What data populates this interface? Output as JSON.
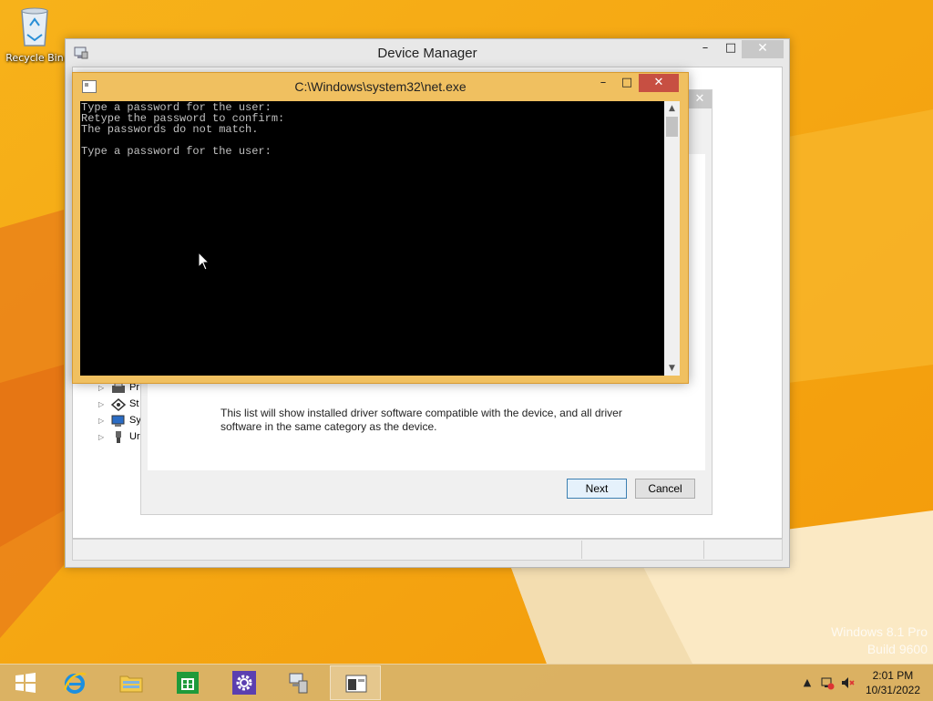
{
  "desktop": {
    "recycle_bin_label": "Recycle Bin",
    "watermark_line1": "Windows 8.1 Pro",
    "watermark_line2": "Build 9600"
  },
  "device_manager": {
    "title": "Device Manager",
    "minimize": "–",
    "maximize": "□",
    "close": "✕",
    "tree_items": [
      {
        "label": "Pr",
        "icon": "printer-icon"
      },
      {
        "label": "St",
        "icon": "storage-icon"
      },
      {
        "label": "Sy",
        "icon": "system-icon"
      },
      {
        "label": "Ur",
        "icon": "usb-icon"
      }
    ]
  },
  "wizard": {
    "close": "✕",
    "description": "This list will show installed driver software compatible with the device, and all driver software in the same category as the device.",
    "next_label": "Next",
    "cancel_label": "Cancel"
  },
  "cmd": {
    "title": "C:\\Windows\\system32\\net.exe",
    "minimize": "–",
    "maximize": "□",
    "close": "✕",
    "lines": [
      "Type a password for the user:",
      "Retype the password to confirm:",
      "The passwords do not match.",
      "",
      "Type a password for the user:"
    ]
  },
  "taskbar": {
    "apps": [
      {
        "name": "start",
        "icon": "windows-logo-icon"
      },
      {
        "name": "internet-explorer",
        "icon": "ie-icon"
      },
      {
        "name": "file-explorer",
        "icon": "folder-icon"
      },
      {
        "name": "store",
        "icon": "store-icon"
      },
      {
        "name": "settings",
        "icon": "gear-icon"
      },
      {
        "name": "device-manager",
        "icon": "device-manager-icon"
      },
      {
        "name": "command-prompt",
        "icon": "cmd-icon"
      }
    ],
    "time": "2:01 PM",
    "date": "10/31/2022"
  },
  "colors": {
    "desktop": "#f4a90f",
    "cmd_frame": "#f0c060",
    "close_red": "#c74f42"
  }
}
